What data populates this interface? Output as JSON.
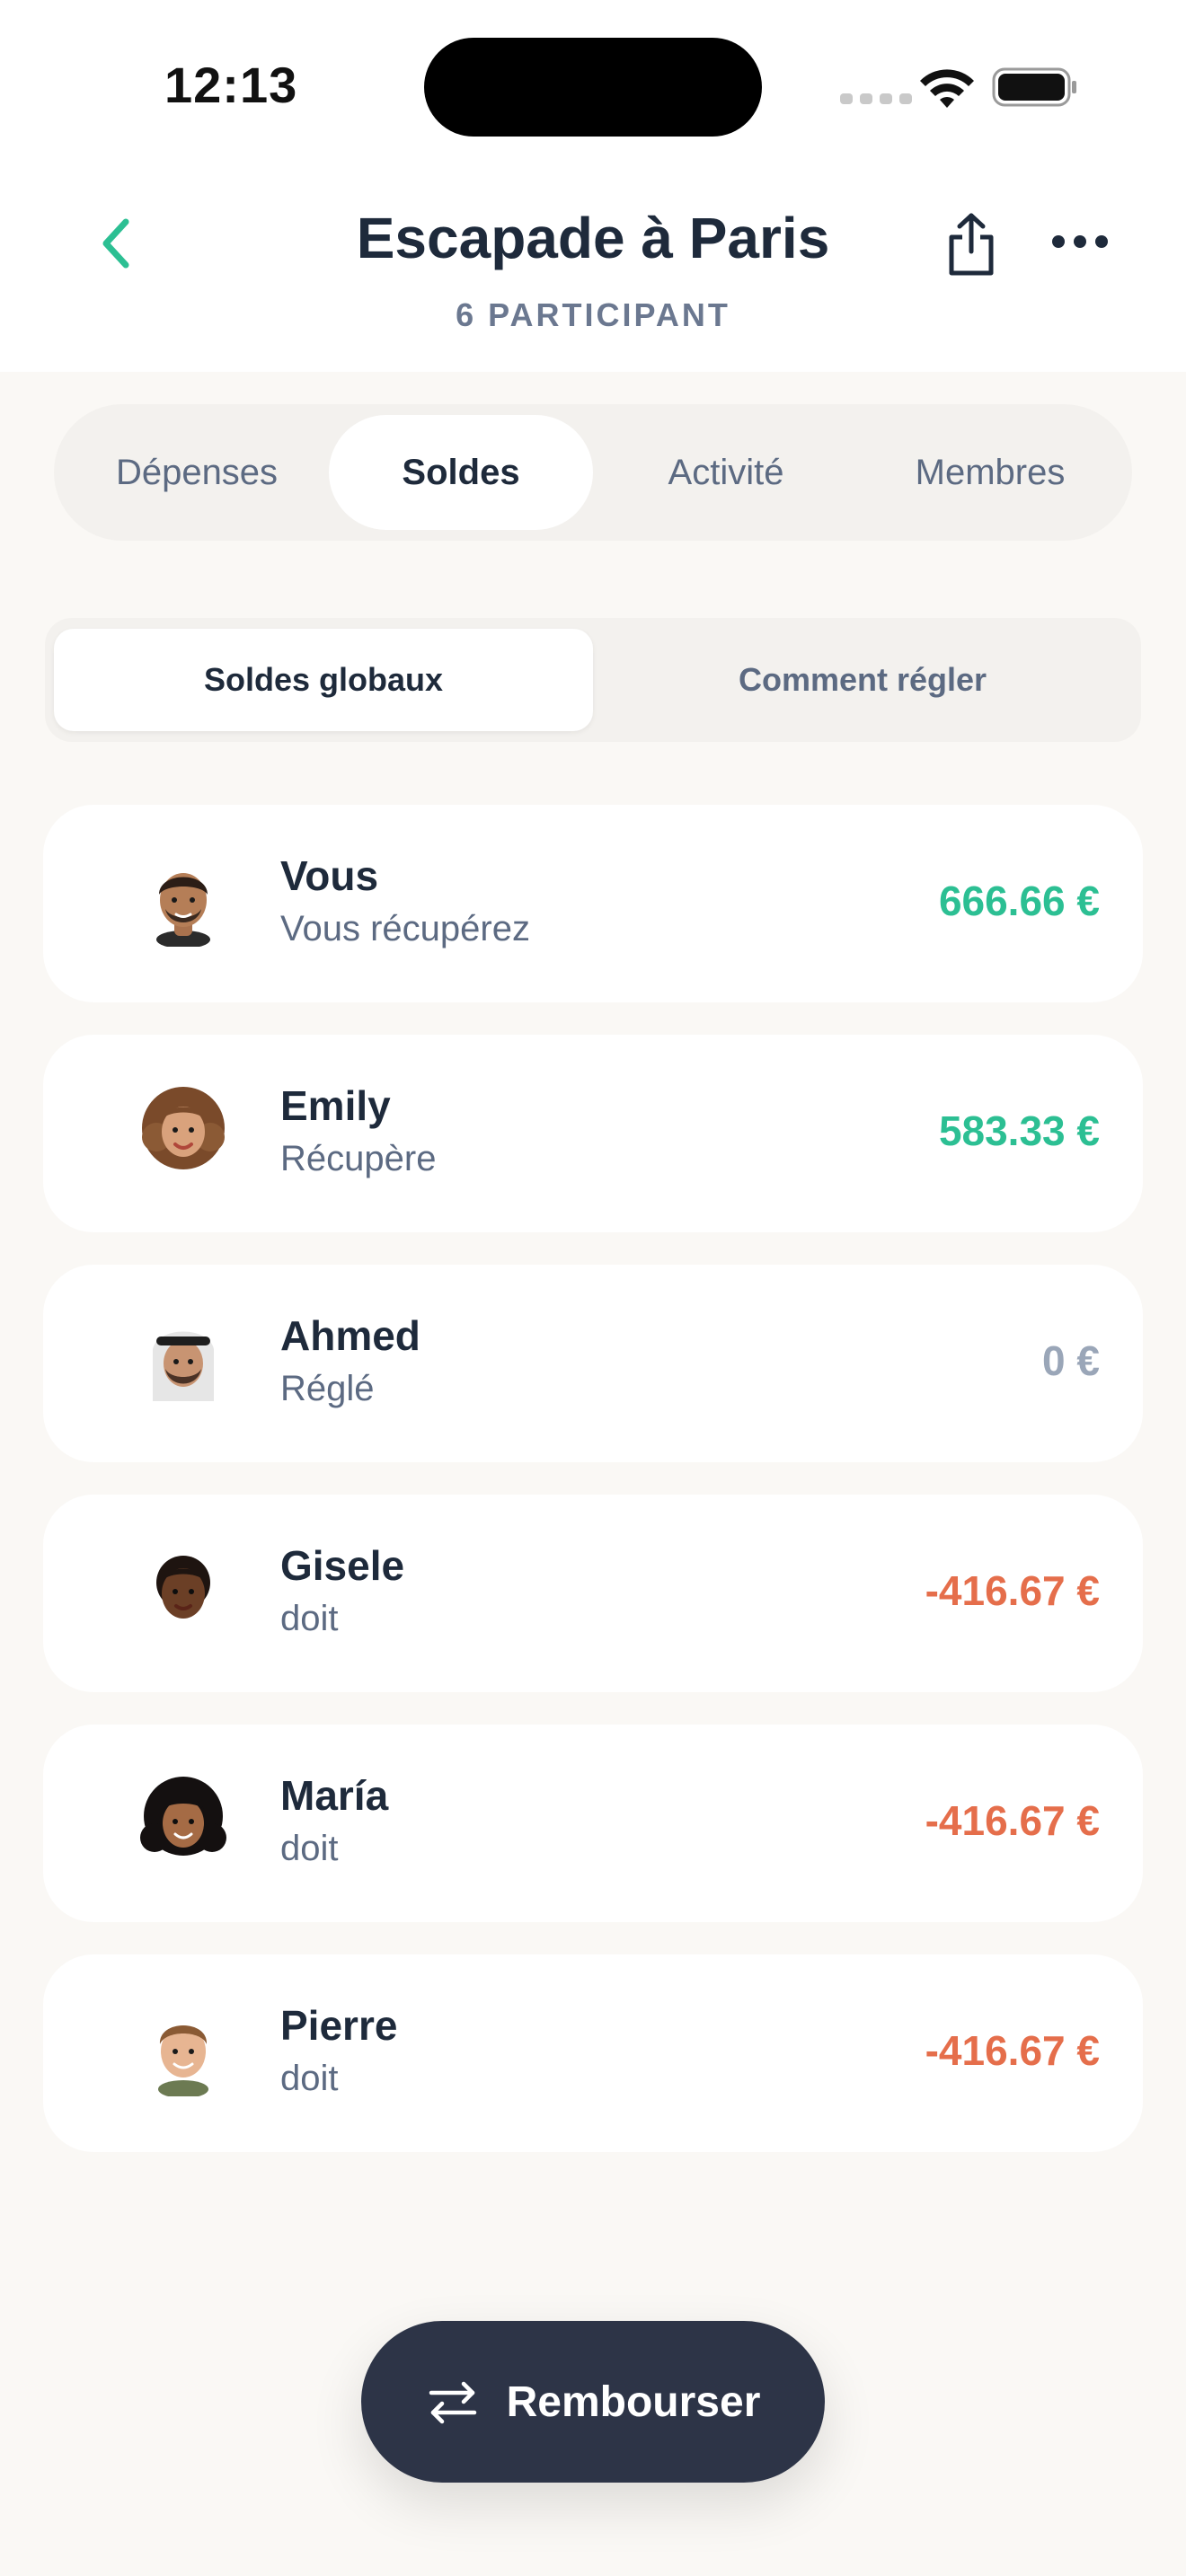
{
  "status_bar": {
    "time": "12:13"
  },
  "header": {
    "title": "Escapade à Paris",
    "subtitle": "6 PARTICIPANT"
  },
  "tabs": [
    {
      "label": "Dépenses",
      "active": false
    },
    {
      "label": "Soldes",
      "active": true
    },
    {
      "label": "Activité",
      "active": false
    },
    {
      "label": "Membres",
      "active": false
    }
  ],
  "segments": [
    {
      "label": "Soldes globaux",
      "active": true
    },
    {
      "label": "Comment régler",
      "active": false
    }
  ],
  "balances": [
    {
      "name": "Vous",
      "status": "Vous récupérez",
      "amount": "666.66 €",
      "kind": "positive"
    },
    {
      "name": "Emily",
      "status": "Récupère",
      "amount": "583.33 €",
      "kind": "positive"
    },
    {
      "name": "Ahmed",
      "status": "Réglé",
      "amount": "0 €",
      "kind": "zero"
    },
    {
      "name": "Gisele",
      "status": "doit",
      "amount": "-416.67 €",
      "kind": "negative"
    },
    {
      "name": "María",
      "status": "doit",
      "amount": "-416.67 €",
      "kind": "negative"
    },
    {
      "name": "Pierre",
      "status": "doit",
      "amount": "-416.67 €",
      "kind": "negative"
    }
  ],
  "fab": {
    "label": "Rembourser",
    "icon": "swap-arrows-icon"
  },
  "colors": {
    "accent": "#2CBF93",
    "negative": "#E56E4B",
    "neutral": "#9AA6B8",
    "dark": "#2D3447"
  }
}
